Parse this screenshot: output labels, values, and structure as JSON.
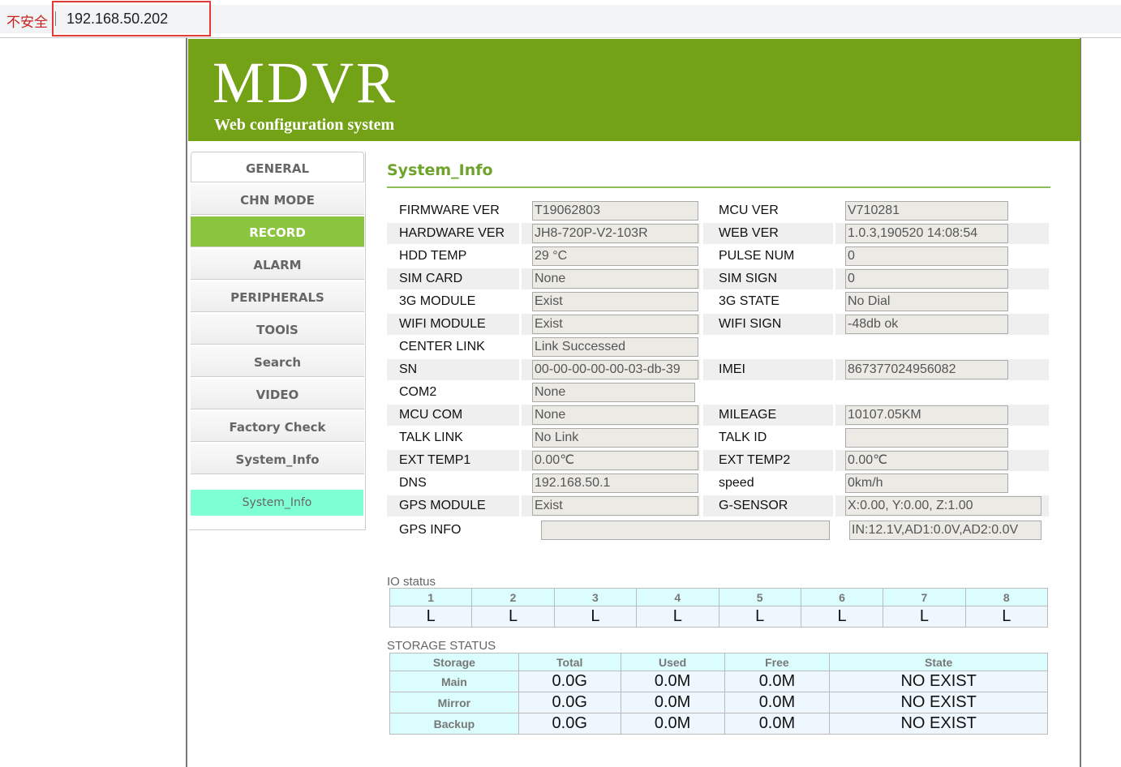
{
  "browser": {
    "security_label": "不安全",
    "url": "192.168.50.202"
  },
  "header": {
    "logo": "MDVR",
    "subtitle": "Web configuration system",
    "brand_color": "#74a217"
  },
  "sidebar": {
    "items": [
      {
        "label": "GENERAL"
      },
      {
        "label": "CHN MODE"
      },
      {
        "label": "RECORD",
        "active": true
      },
      {
        "label": "ALARM"
      },
      {
        "label": "PERIPHERALS"
      },
      {
        "label": "TOOlS"
      },
      {
        "label": "Search"
      },
      {
        "label": "VIDEO"
      },
      {
        "label": "Factory Check"
      },
      {
        "label": "System_Info"
      }
    ],
    "sub_item": "System_Info"
  },
  "main": {
    "title": "System_Info",
    "rows": [
      {
        "l1": "FIRMWARE VER",
        "v1": "T19062803",
        "l2": "MCU VER",
        "v2": "V710281"
      },
      {
        "l1": "HARDWARE VER",
        "v1": "JH8-720P-V2-103R",
        "l2": "WEB VER",
        "v2": "1.0.3,190520 14:08:54"
      },
      {
        "l1": "HDD TEMP",
        "v1": "29 °C",
        "l2": "PULSE NUM",
        "v2": "0"
      },
      {
        "l1": "SIM CARD",
        "v1": "None",
        "l2": "SIM SIGN",
        "v2": "0"
      },
      {
        "l1": "3G MODULE",
        "v1": "Exist",
        "l2": "3G STATE",
        "v2": "No Dial"
      },
      {
        "l1": "WIFI MODULE",
        "v1": "Exist",
        "l2": "WIFI SIGN",
        "v2": "-48db ok"
      },
      {
        "l1": "CENTER LINK",
        "v1": "Link Successed"
      },
      {
        "l1": "SN",
        "v1": "00-00-00-00-00-03-db-39",
        "l2": "IMEI",
        "v2": "867377024956082"
      },
      {
        "l1": "COM2",
        "v1": "None"
      },
      {
        "l1": "MCU COM",
        "v1": "None",
        "l2": "MILEAGE",
        "v2": "10107.05KM"
      },
      {
        "l1": "TALK LINK",
        "v1": "No Link",
        "l2": "TALK ID",
        "v2": ""
      },
      {
        "l1": "EXT TEMP1",
        "v1": "0.00℃",
        "l2": "EXT TEMP2",
        "v2": "0.00℃"
      },
      {
        "l1": "DNS",
        "v1": "192.168.50.1",
        "l2": "speed",
        "v2": "0km/h"
      },
      {
        "l1": "GPS MODULE",
        "v1": "Exist",
        "l2": "G-SENSOR",
        "v2": "X:0.00, Y:0.00, Z:1.00"
      }
    ],
    "gps_info": {
      "label": "GPS INFO",
      "value": "",
      "voltage": "IN:12.1V,AD1:0.0V,AD2:0.0V"
    },
    "io": {
      "label": "IO status",
      "headers": [
        "1",
        "2",
        "3",
        "4",
        "5",
        "6",
        "7",
        "8"
      ],
      "values": [
        "L",
        "L",
        "L",
        "L",
        "L",
        "L",
        "L",
        "L"
      ]
    },
    "storage": {
      "label": "STORAGE STATUS",
      "headers": [
        "Storage",
        "Total",
        "Used",
        "Free",
        "State"
      ],
      "rows": [
        [
          "Main",
          "0.0G",
          "0.0M",
          "0.0M",
          "NO EXIST"
        ],
        [
          "Mirror",
          "0.0G",
          "0.0M",
          "0.0M",
          "NO EXIST"
        ],
        [
          "Backup",
          "0.0G",
          "0.0M",
          "0.0M",
          "NO EXIST"
        ]
      ]
    }
  }
}
